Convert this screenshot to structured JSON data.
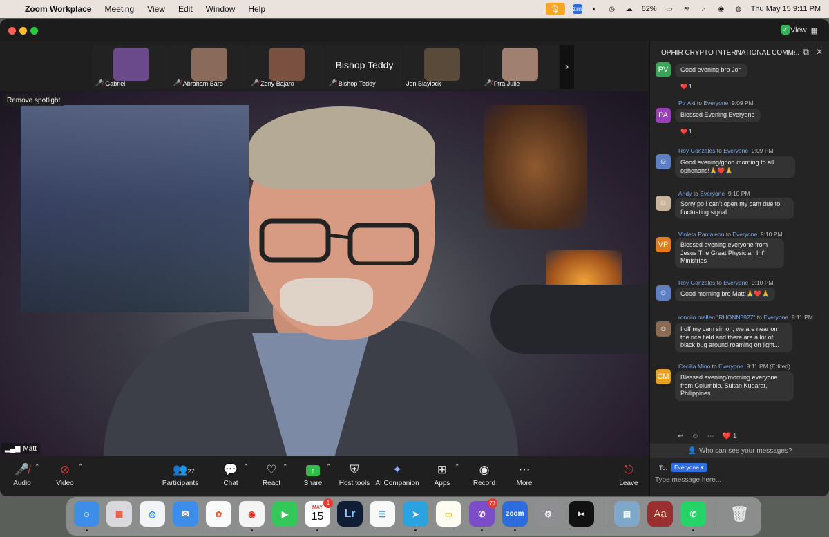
{
  "menubar": {
    "app_name": "Zoom Workplace",
    "menus": [
      "Meeting",
      "View",
      "Edit",
      "Window",
      "Help"
    ],
    "battery": "62%",
    "datetime": "Thu May 15  9:11 PM"
  },
  "window": {
    "view_label": "View"
  },
  "participants_strip": [
    {
      "name": "Gabriel",
      "muted": true,
      "color": "#6a4a8a"
    },
    {
      "name": "Abraham Baro",
      "muted": true,
      "color": "#8a6a5a"
    },
    {
      "name": "Zeny Bajaro",
      "muted": true,
      "color": "#7a5040"
    },
    {
      "name": "Bishop Teddy",
      "muted": true,
      "text_only": true,
      "display": "Bishop Teddy"
    },
    {
      "name": "Jon Blaylock",
      "muted": false,
      "color": "#5a4a3a"
    },
    {
      "name": "Ptra.Julie",
      "muted": true,
      "color": "#a08070"
    }
  ],
  "video": {
    "remove_spotlight": "Remove spotlight",
    "speaker": "Matt"
  },
  "toolbar": {
    "audio": "Audio",
    "video": "Video",
    "participants": "Participants",
    "participants_count": "27",
    "chat": "Chat",
    "react": "React",
    "share": "Share",
    "host_tools": "Host tools",
    "ai_companion": "AI Companion",
    "apps": "Apps",
    "record": "Record",
    "more": "More",
    "leave": "Leave"
  },
  "chat": {
    "title": "OPHIR CRYPTO INTERNATIONAL COMM...",
    "messages": [
      {
        "initials": "PV",
        "avatar_color": "#3aa356",
        "sender": "",
        "to": "",
        "time": "",
        "text": "Good evening bro Jon",
        "reaction": "❤️ 1"
      },
      {
        "initials": "PA",
        "avatar_color": "#9b3fb8",
        "sender": "Ptr Aki",
        "to": "Everyone",
        "time": "9:09 PM",
        "text": "Blessed Evening Everyone",
        "reaction": "❤️ 1"
      },
      {
        "initials": "",
        "avatar_color": "#5d7fc4",
        "sender": "Roy Gonzales",
        "to": "Everyone",
        "time": "9:09 PM",
        "text": "Good evening/good morning to all ophenans!🙏❤️🙏",
        "reaction": ""
      },
      {
        "initials": "",
        "avatar_color": "#c9b39a",
        "sender": "Andy",
        "to": "Everyone",
        "time": "9:10 PM",
        "text": "Sorry po I can't open my cam due to fluctuating signal",
        "reaction": ""
      },
      {
        "initials": "VP",
        "avatar_color": "#e07b1f",
        "sender": "Violeta Pantaleon",
        "to": "Everyone",
        "time": "9:10 PM",
        "text": "Blessed  evening everyone  from Jesus  The Great Physician Int'l Ministries",
        "reaction": ""
      },
      {
        "initials": "",
        "avatar_color": "#5d7fc4",
        "sender": "Roy Gonzales",
        "to": "Everyone",
        "time": "9:10 PM",
        "text": "Good morning bro Matt!🙏❤️🙏",
        "reaction": ""
      },
      {
        "initials": "",
        "avatar_color": "#8a6a50",
        "sender": "ronnilo mallen \"RHONN3927\"",
        "to": "Everyone",
        "time": "9:11 PM",
        "text": "I off my cam sir jon, we are near on the rice field and there are a lot of black bug around roaming on light...",
        "reaction": ""
      },
      {
        "initials": "CM",
        "avatar_color": "#e8a020",
        "sender": "Cecilia Mino",
        "to": "Everyone",
        "time": "9:11 PM (Edited)",
        "text": "Blessed evening/morning everyone from Columbio, Sultan Kudarat, Philippines",
        "reaction": ""
      }
    ],
    "actions_reaction": "❤️ 1",
    "who_can_see": "Who can see your messages?",
    "to_label": "To:",
    "to_value": "Everyone",
    "input_placeholder": "Type message here..."
  },
  "dock": {
    "calendar_month": "MAY",
    "calendar_day": "15",
    "calendar_badge": "1",
    "viber_badge": "77",
    "zoom_label": "zoom",
    "lr_label": "Lr",
    "dictionary_label": "Aa"
  }
}
